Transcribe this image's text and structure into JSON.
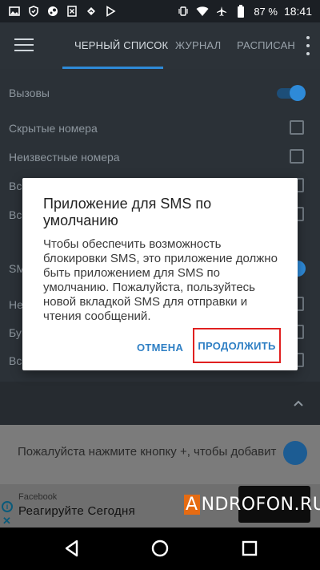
{
  "status_bar": {
    "battery": "87 %",
    "time": "18:41",
    "left_icons": [
      "image-icon",
      "shield-icon",
      "steam-icon",
      "sheet-icon",
      "arrow-icon",
      "play-store-icon"
    ],
    "right_icons": [
      "vibrate-icon",
      "wifi-icon",
      "airplane-icon",
      "battery-icon"
    ]
  },
  "app_bar": {
    "tabs": [
      {
        "label": "ЧЕРНЫЙ СПИСОК",
        "active": true
      },
      {
        "label": "ЖУРНАЛ",
        "active": false
      },
      {
        "label": "РАСПИСАН",
        "active": false
      }
    ],
    "accent": "#2e8ad8"
  },
  "settings": {
    "rows": [
      {
        "label": "Вызовы",
        "control": "switch",
        "on": true
      },
      {
        "label": "Скрытые номера",
        "control": "checkbox",
        "checked": false
      },
      {
        "label": "Неизвестные номера",
        "control": "checkbox",
        "checked": false
      },
      {
        "label": "Вс",
        "control": "checkbox",
        "checked": false
      },
      {
        "label": "Вс",
        "control": "checkbox",
        "checked": false
      },
      {
        "label": "SMS",
        "control": "switch",
        "on": true
      },
      {
        "label": "Не",
        "control": "checkbox",
        "checked": false
      },
      {
        "label": "Бу",
        "control": "checkbox",
        "checked": false
      },
      {
        "label": "Вс",
        "control": "checkbox",
        "checked": false
      }
    ]
  },
  "lower": {
    "hint": "Пожалуйста нажмите кнопку +, чтобы добавит"
  },
  "ad": {
    "source": "Facebook",
    "title": "Реагируйте Сегодня"
  },
  "watermark": {
    "prefix": "A",
    "rest": "NDROFON.RU"
  },
  "dialog": {
    "title": "Приложение для SMS по умолчанию",
    "body": "Чтобы обеспечить возможность блокировки SMS, это приложение должно быть приложением для SMS по умолчанию. Пожалуйста, пользуйтесь новой вкладкой SMS для отправки и чтения сообщений.",
    "cancel_label": "ОТМЕНА",
    "continue_label": "ПРОДОЛЖИТЬ",
    "highlight_color": "#e02020"
  },
  "nav_bar": {
    "icons": [
      "back-icon",
      "home-icon",
      "recents-icon"
    ]
  }
}
